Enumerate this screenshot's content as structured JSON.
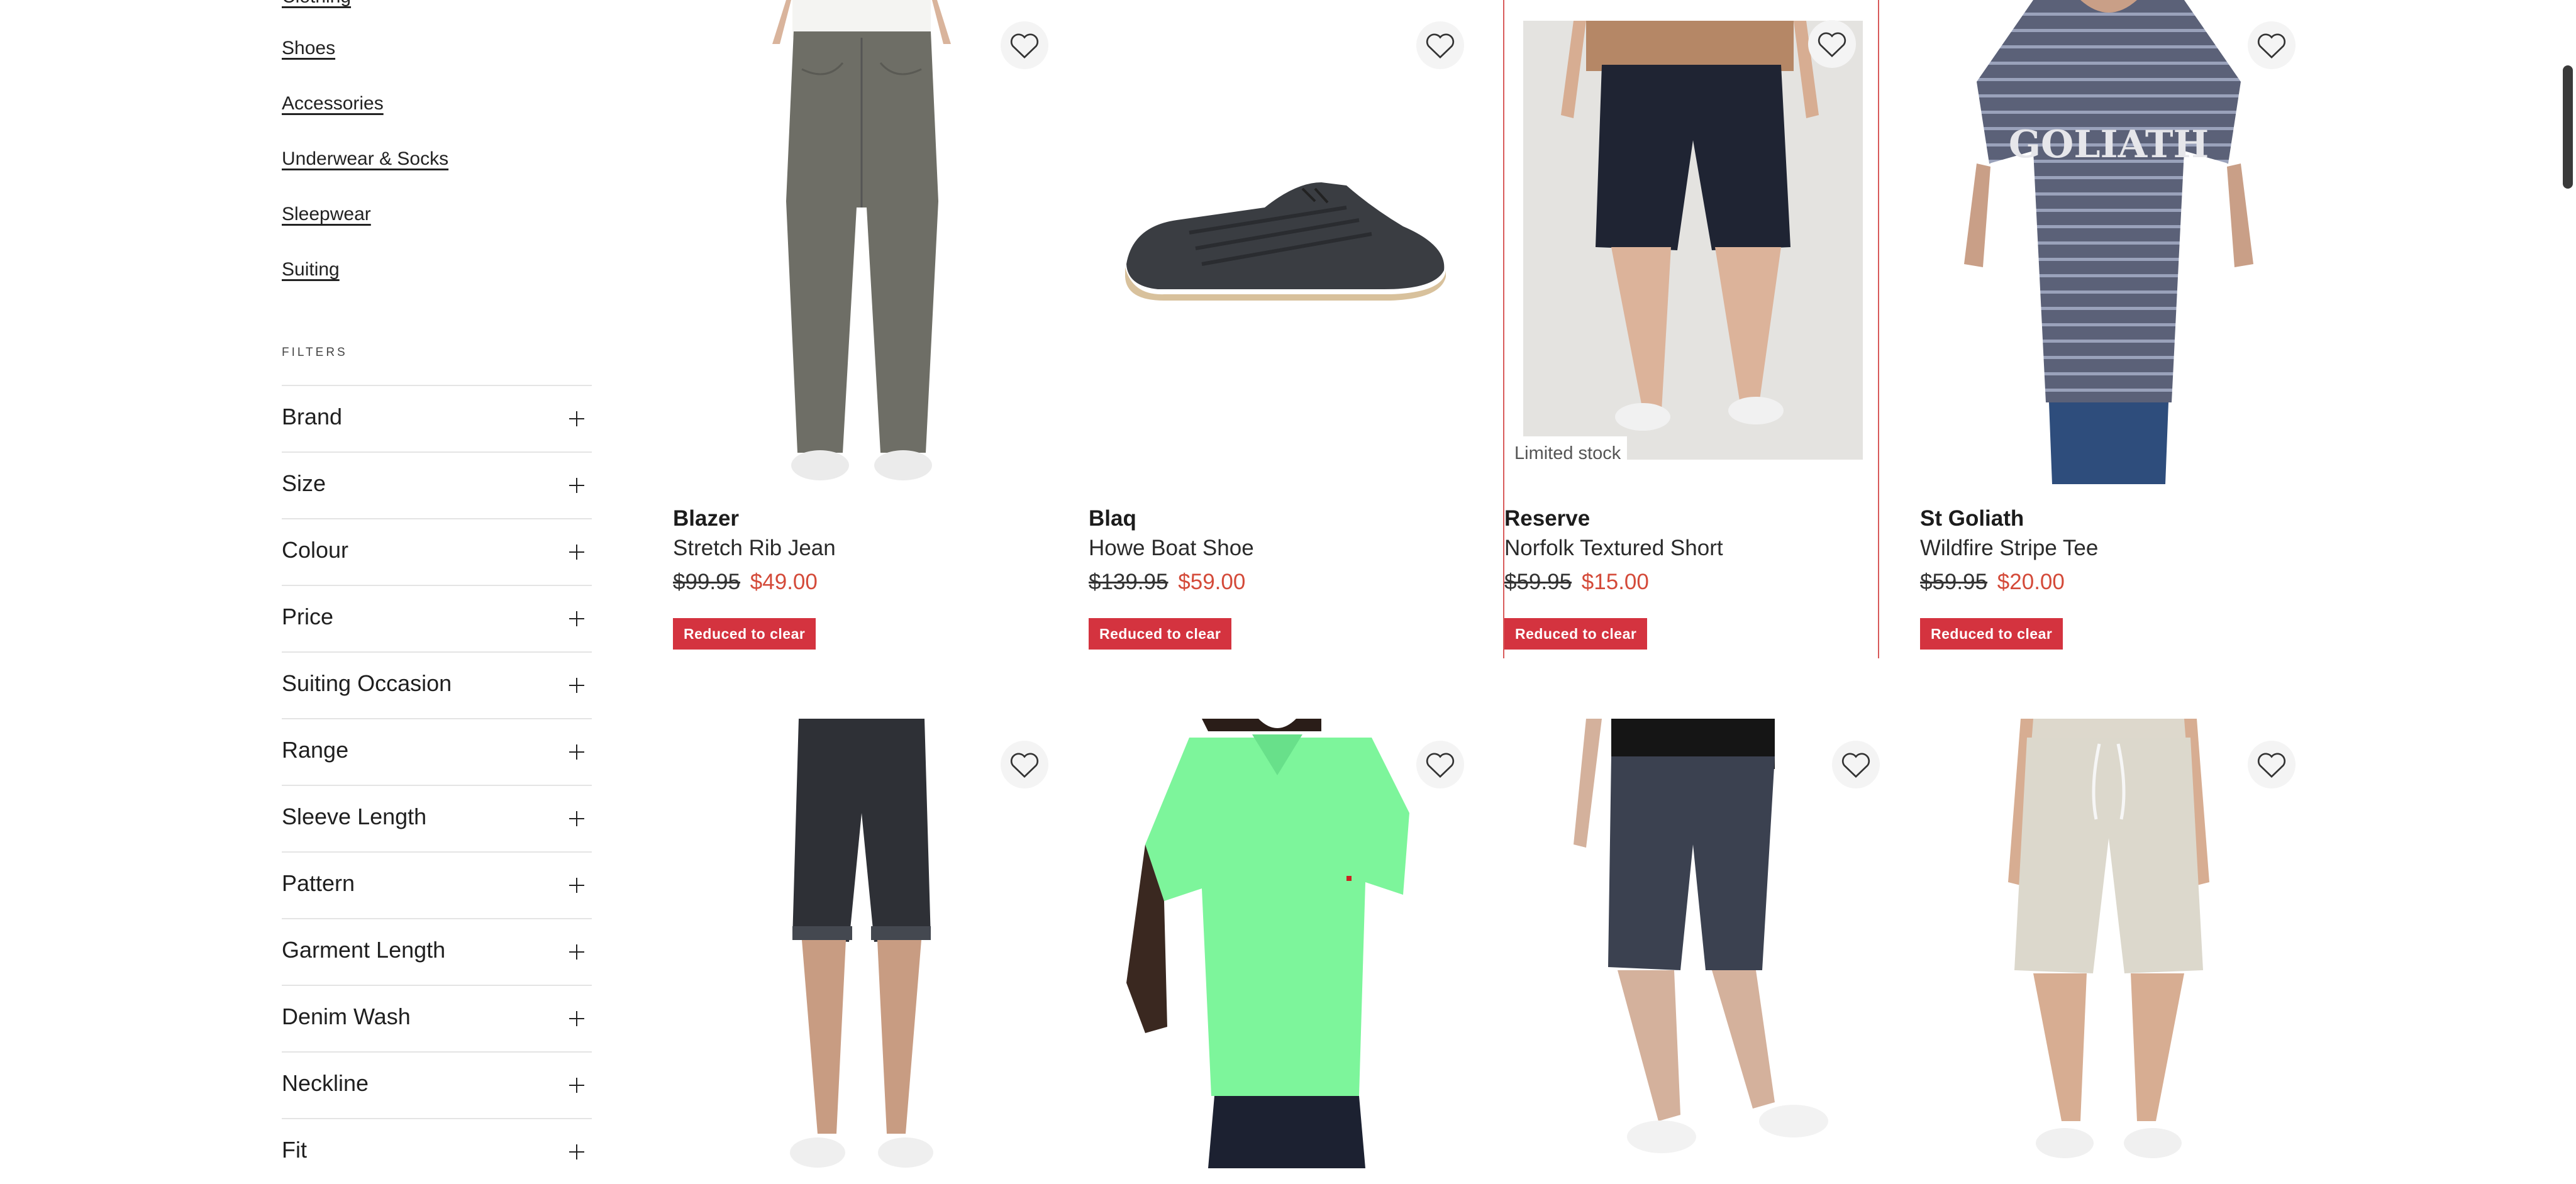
{
  "sidebar": {
    "categories": [
      {
        "label": "Clothing"
      },
      {
        "label": "Shoes"
      },
      {
        "label": "Accessories"
      },
      {
        "label": "Underwear & Socks"
      },
      {
        "label": "Sleepwear"
      },
      {
        "label": "Suiting"
      }
    ],
    "filters_title": "FILTERS",
    "filters": [
      {
        "label": "Brand"
      },
      {
        "label": "Size"
      },
      {
        "label": "Colour"
      },
      {
        "label": "Price"
      },
      {
        "label": "Suiting Occasion"
      },
      {
        "label": "Range"
      },
      {
        "label": "Sleeve Length"
      },
      {
        "label": "Pattern"
      },
      {
        "label": "Garment Length"
      },
      {
        "label": "Denim Wash"
      },
      {
        "label": "Neckline"
      },
      {
        "label": "Fit"
      }
    ]
  },
  "products": [
    {
      "brand": "Blazer",
      "name": "Stretch Rib Jean",
      "was_price": "$99.95",
      "now_price": "$49.00",
      "badge": "Reduced to clear",
      "image_icon": "jeans-image"
    },
    {
      "brand": "Blaq",
      "name": "Howe Boat Shoe",
      "was_price": "$139.95",
      "now_price": "$59.00",
      "badge": "Reduced to clear",
      "image_icon": "shoe-image"
    },
    {
      "brand": "Reserve",
      "name": "Norfolk Textured Short",
      "was_price": "$59.95",
      "now_price": "$15.00",
      "badge": "Reduced to clear",
      "stock_label": "Limited stock",
      "image_icon": "shorts-image"
    },
    {
      "brand": "St Goliath",
      "name": "Wildfire Stripe Tee",
      "was_price": "$59.95",
      "now_price": "$20.00",
      "badge": "Reduced to clear",
      "tee_print": "GOLIATH",
      "image_icon": "tee-image"
    },
    {
      "image_icon": "denim-shorts-image"
    },
    {
      "image_icon": "polo-image"
    },
    {
      "image_icon": "track-shorts-image"
    },
    {
      "image_icon": "linen-shorts-image"
    }
  ],
  "colors": {
    "sale_price": "#d44a39",
    "badge_bg": "#d4333f",
    "selected_outline": "#d85a5a"
  }
}
